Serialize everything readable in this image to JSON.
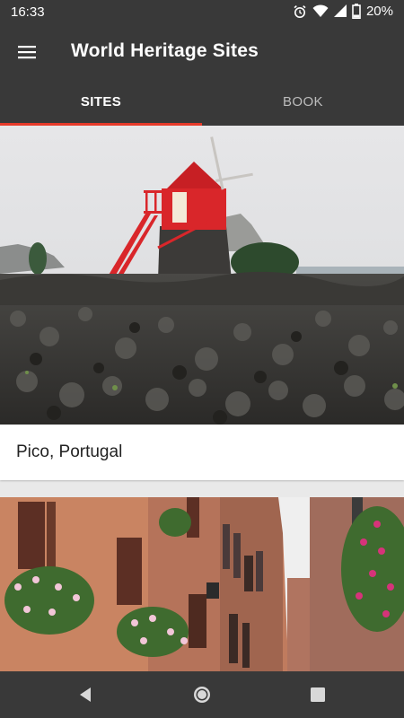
{
  "status_bar": {
    "time": "16:33",
    "battery_percent": "20%",
    "icons": [
      "alarm-icon",
      "wifi-icon",
      "signal-icon",
      "battery-icon"
    ]
  },
  "app_bar": {
    "menu_icon": "hamburger-menu-icon",
    "title": "World Heritage Sites"
  },
  "tabs": [
    {
      "label": "SITES",
      "selected": true
    },
    {
      "label": "BOOK",
      "selected": false
    }
  ],
  "sites": [
    {
      "name": "Pico, Portugal",
      "image": "windmill-lava-stone-walls"
    },
    {
      "name": "",
      "image": "brick-street-flower-balconies"
    }
  ],
  "nav_bar": {
    "buttons": [
      "back-icon",
      "home-icon",
      "recents-icon"
    ]
  },
  "colors": {
    "bar": "#393939",
    "accent": "#e63a2a",
    "card": "#ffffff"
  }
}
